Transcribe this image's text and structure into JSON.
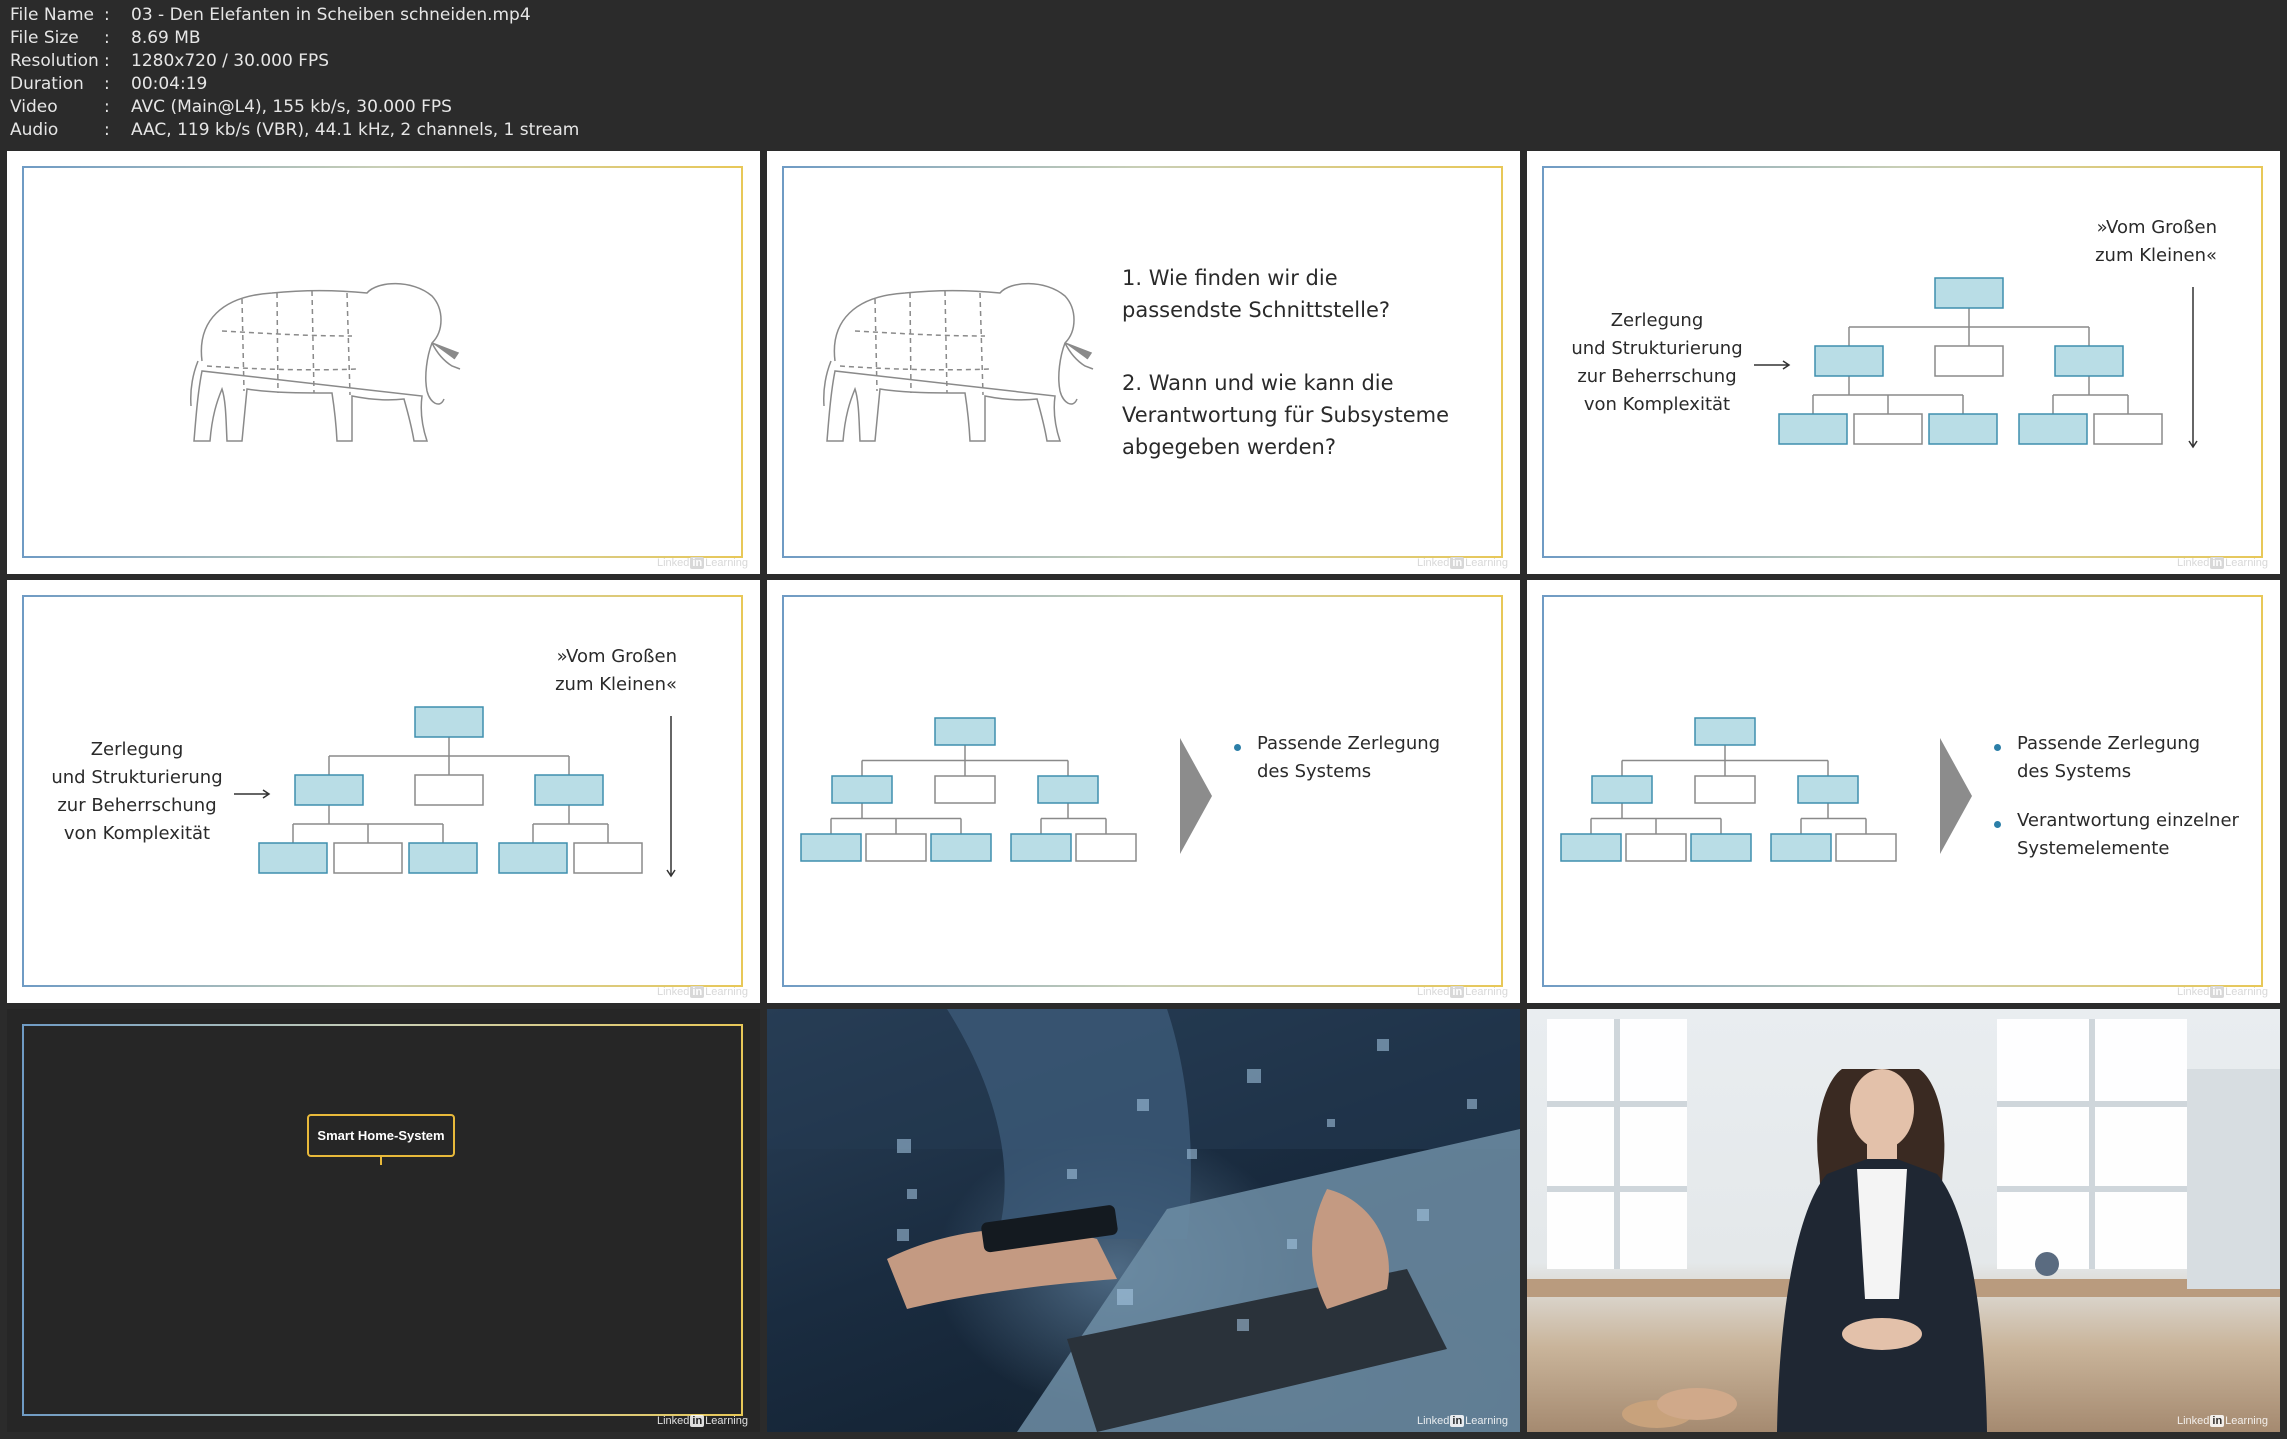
{
  "file_info": [
    {
      "key": "File Name",
      "sep": ":",
      "value": "03 - Den Elefanten in Scheiben schneiden.mp4"
    },
    {
      "key": "File Size",
      "sep": ":",
      "value": "8.69 MB"
    },
    {
      "key": "Resolution",
      "sep": ":",
      "value": "1280x720 / 30.000 FPS"
    },
    {
      "key": "Duration",
      "sep": ":",
      "value": "00:04:19"
    },
    {
      "key": "Video",
      "sep": ":",
      "value": "AVC (Main@L4), 155 kb/s, 30.000 FPS"
    },
    {
      "key": "Audio",
      "sep": ":",
      "value": "AAC, 119 kb/s (VBR), 44.1 kHz, 2 channels, 1 stream"
    }
  ],
  "watermark": {
    "pre": "Linked",
    "in": "in",
    "post": "Learning"
  },
  "thumb2": {
    "q1_line1": "1. Wie finden wir die",
    "q1_line2": "passendste Schnittstelle?",
    "q2_line1": "2. Wann und wie kann die",
    "q2_line2": "Verantwortung für Subsysteme",
    "q2_line3": "abgegeben werden?"
  },
  "decomposition": {
    "label_line1": "Zerlegung",
    "label_line2": "und Strukturierung",
    "label_line3": "zur Beherrschung",
    "label_line4": "von Komplexität",
    "direction_line1": "»Vom Großen",
    "direction_line2": "zum Kleinen«"
  },
  "bullets": {
    "b1_line1": "Passende Zerlegung",
    "b1_line2": "des Systems",
    "b2_line1": "Verantwortung einzelner",
    "b2_line2": "Systemelemente"
  },
  "thumb7": {
    "box_label": "Smart Home-System"
  },
  "colors": {
    "accent_box": "#b9dde6",
    "accent_border": "#3f8fae",
    "bullet": "#2c7fa8",
    "highlight_border": "#e8b93a"
  }
}
